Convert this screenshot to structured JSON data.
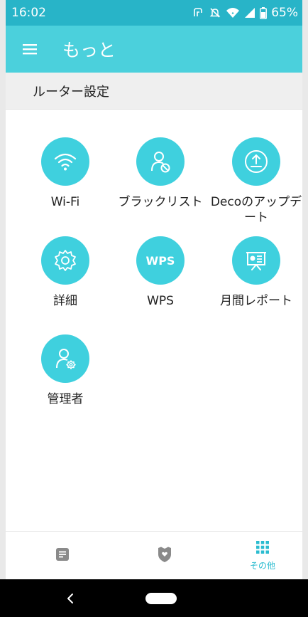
{
  "status_bar": {
    "time": "16:02",
    "battery": "65%",
    "icons": [
      "nfc-icon",
      "mute-icon",
      "wifi-icon",
      "signal-icon",
      "battery-icon"
    ]
  },
  "app_bar": {
    "title": "もっと",
    "menu_icon": "hamburger-menu-icon"
  },
  "section": {
    "title": "ルーター設定"
  },
  "tiles": [
    {
      "id": "wifi",
      "label": "Wi-Fi",
      "icon": "wifi-icon"
    },
    {
      "id": "blacklist",
      "label": "ブラックリスト",
      "icon": "user-block-icon"
    },
    {
      "id": "deco-update",
      "label": "Decoのアップデート",
      "icon": "upload-icon"
    },
    {
      "id": "advanced",
      "label": "詳細",
      "icon": "gear-icon"
    },
    {
      "id": "wps",
      "label": "WPS",
      "icon_text": "WPS"
    },
    {
      "id": "monthly-report",
      "label": "月間レポート",
      "icon": "presentation-icon"
    },
    {
      "id": "admin",
      "label": "管理者",
      "icon": "user-gear-icon"
    }
  ],
  "bottom_nav": {
    "items": [
      {
        "id": "overview",
        "icon": "list-icon",
        "label": ""
      },
      {
        "id": "security",
        "icon": "shield-heart-icon",
        "label": ""
      },
      {
        "id": "more",
        "icon": "grid-icon",
        "label": "その他",
        "active": true
      }
    ]
  },
  "colors": {
    "status_bar": "#28b4c8",
    "app_bar": "#4bd0dc",
    "accent": "#3fd0de",
    "active_nav": "#2bbcd0"
  }
}
